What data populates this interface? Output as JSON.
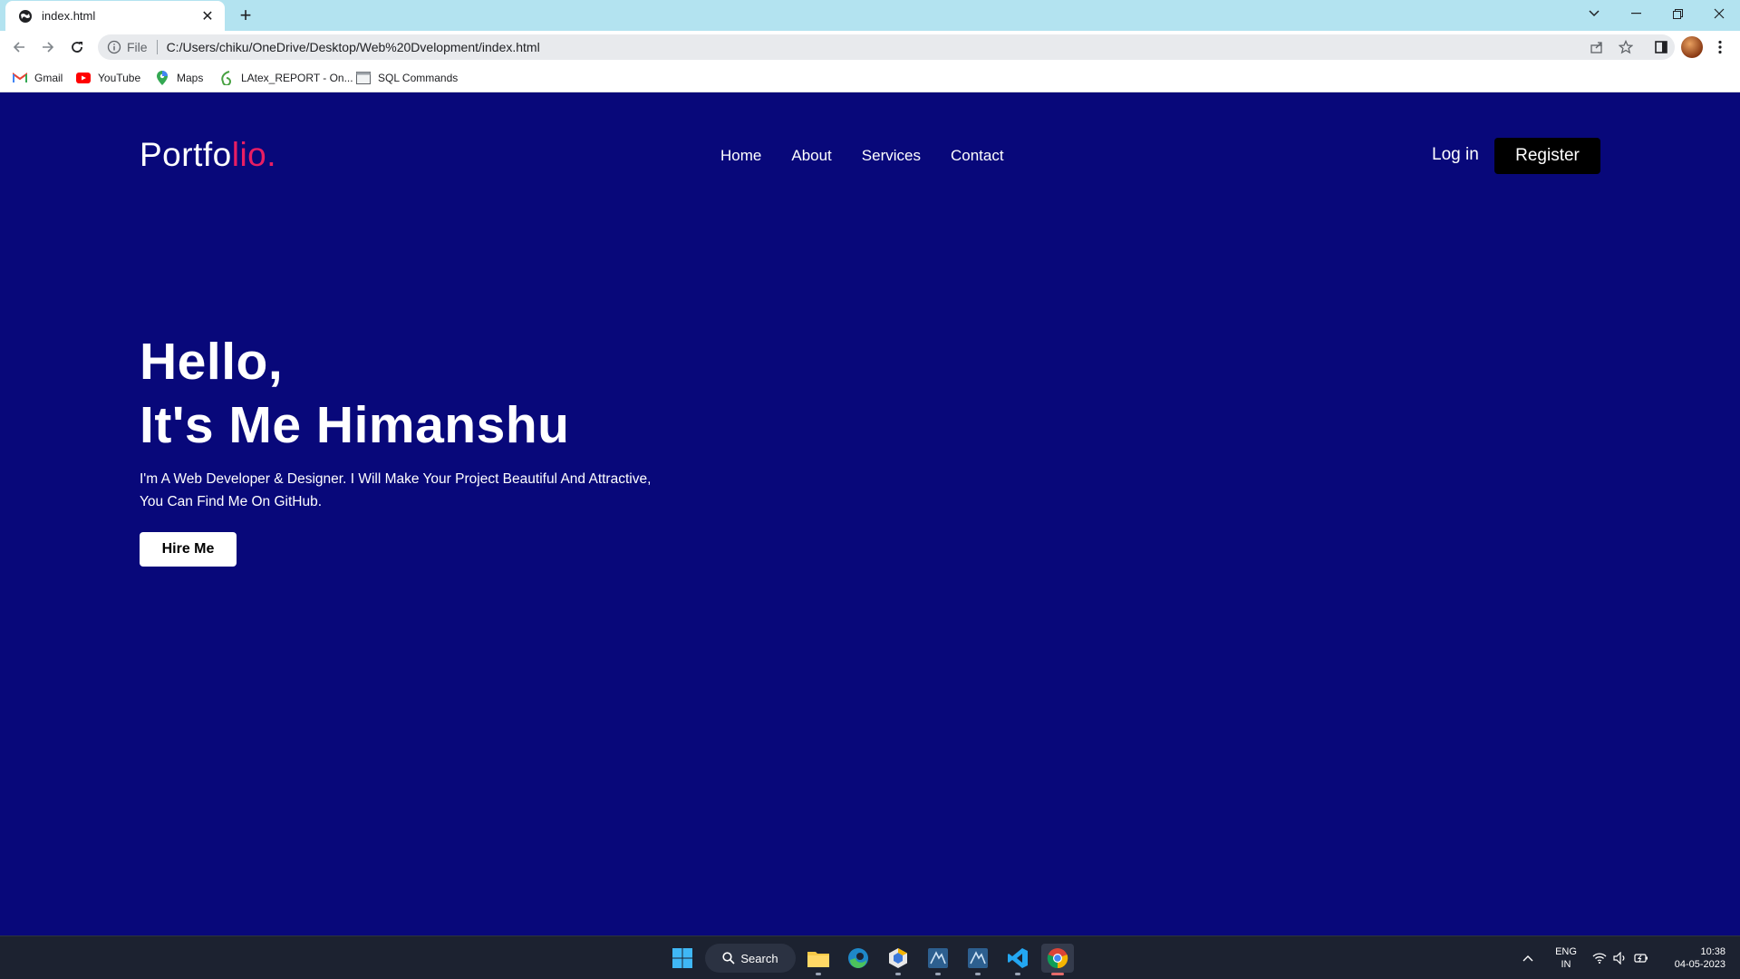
{
  "browser": {
    "tab_title": "index.html",
    "new_tab": "+",
    "url_scheme": "File",
    "url": "C:/Users/chiku/OneDrive/Desktop/Web%20Dvelopment/index.html",
    "bookmarks": [
      {
        "label": "Gmail",
        "icon": "gmail-icon"
      },
      {
        "label": "YouTube",
        "icon": "youtube-icon"
      },
      {
        "label": "Maps",
        "icon": "maps-icon"
      },
      {
        "label": "LAtex_REPORT - On...",
        "icon": "overleaf-icon"
      },
      {
        "label": "SQL Commands",
        "icon": "page-icon"
      }
    ]
  },
  "site": {
    "logo_main": "Portfo",
    "logo_accent": "lio.",
    "nav": [
      "Home",
      "About",
      "Services",
      "Contact"
    ],
    "login": "Log in",
    "register": "Register",
    "hero_line1": "Hello,",
    "hero_line2": "It's Me Himanshu",
    "hero_p1": "I'm A Web Developer & Designer. I Will Make Your Project Beautiful And Attractive,",
    "hero_p2": "You Can Find Me On GitHub.",
    "hire": "Hire Me",
    "colors": {
      "background": "#08087a",
      "accent": "#e81e63",
      "register_bg": "#000000"
    }
  },
  "taskbar": {
    "search": "Search",
    "lang_line1": "ENG",
    "lang_line2": "IN",
    "time": "10:38",
    "date": "04-05-2023",
    "apps": [
      "start-icon",
      "file-explorer-icon",
      "edge-icon",
      "app-icon",
      "sql-workbench-icon",
      "sql-workbench-icon",
      "vscode-icon",
      "chrome-icon"
    ]
  }
}
